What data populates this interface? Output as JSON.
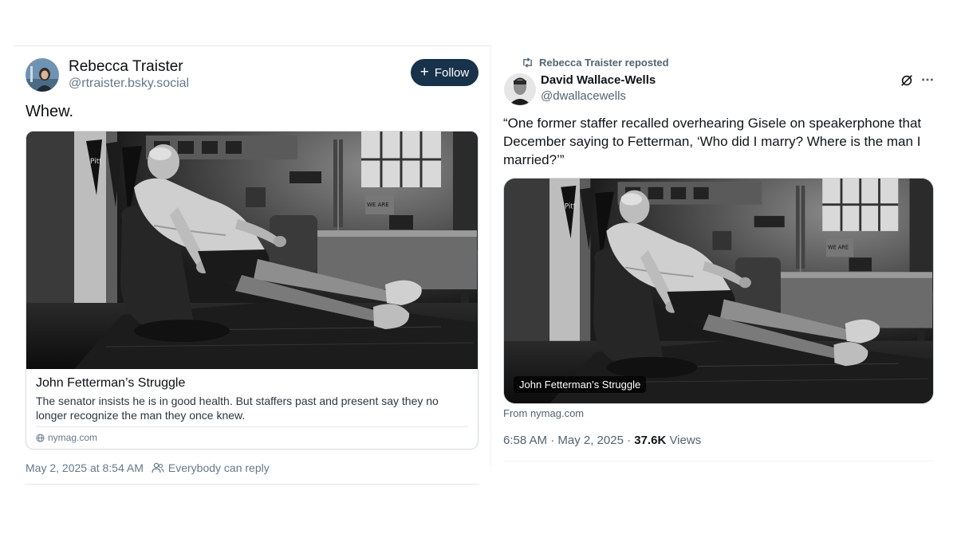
{
  "bluesky_post": {
    "author_name": "Rebecca Traister",
    "author_handle": "@rtraister.bsky.social",
    "follow_label": "Follow",
    "text": "Whew.",
    "link_card": {
      "title": "John Fetterman’s Struggle",
      "description": "The senator insists he is in good health. But staffers past and present say they no longer recognize the man they once knew.",
      "domain": "nymag.com"
    },
    "timestamp": "May 2, 2025 at 8:54 AM",
    "reply_setting": "Everybody can reply",
    "accent_color": "#17324a"
  },
  "x_post": {
    "repost_label": "Rebecca Traister reposted",
    "author_name": "David Wallace-Wells",
    "author_handle": "@dwallacewells",
    "text": "“One former staffer recalled overhearing Gisele on speakerphone that December saying to Fetterman, ‘Who did I marry? Where is the man I married?’”",
    "card_title": "John Fetterman’s Struggle",
    "from_source": "From nymag.com",
    "timestamp": "6:58 AM · May 2, 2025 · ",
    "views_count": "37.6K",
    "views_label": " Views",
    "icons": [
      "repost-icon",
      "grok-icon",
      "more-options-icon"
    ]
  }
}
